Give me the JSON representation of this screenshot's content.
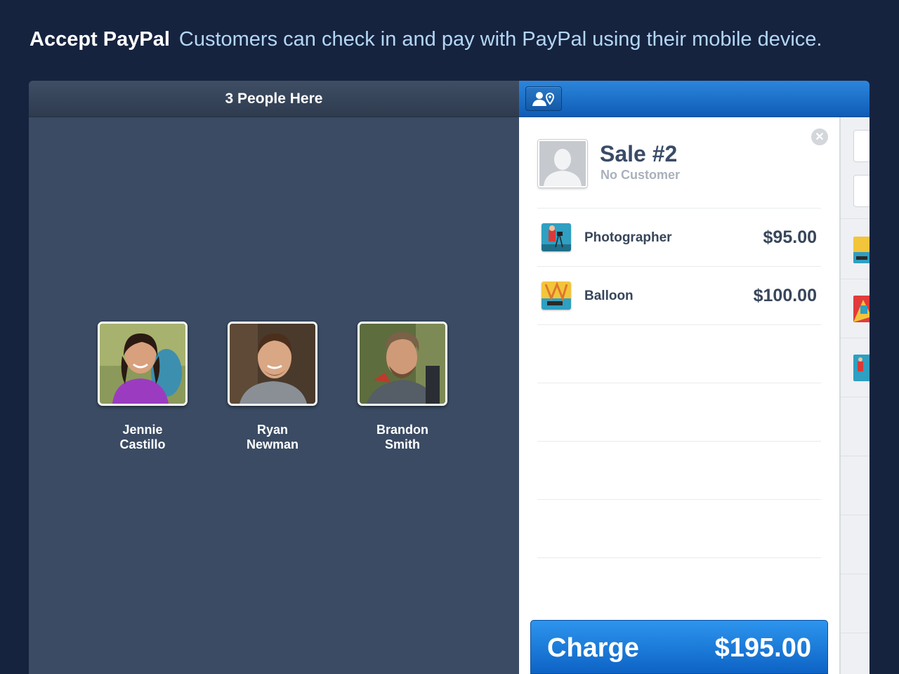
{
  "headline": {
    "title": "Accept PayPal",
    "subtitle": "Customers can check in and pay with PayPal using their mobile device."
  },
  "left_pane": {
    "header": "3 People Here",
    "people": [
      {
        "first": "Jennie",
        "last": "Castillo"
      },
      {
        "first": "Ryan",
        "last": "Newman"
      },
      {
        "first": "Brandon",
        "last": "Smith"
      }
    ]
  },
  "right_pane": {
    "checkin_icon": "person-location-icon",
    "sale": {
      "title": "Sale #2",
      "customer": "No Customer",
      "close_icon": "close-icon",
      "items": [
        {
          "name": "Photographer",
          "price": "$95.00",
          "icon": "photographer-item-icon"
        },
        {
          "name": "Balloon",
          "price": "$100.00",
          "icon": "balloon-item-icon"
        }
      ]
    },
    "charge": {
      "label": "Charge",
      "amount": "$195.00"
    }
  },
  "colors": {
    "background": "#16233f",
    "accent_blue": "#1a73d0",
    "headline_sub": "#b3d7f5"
  }
}
